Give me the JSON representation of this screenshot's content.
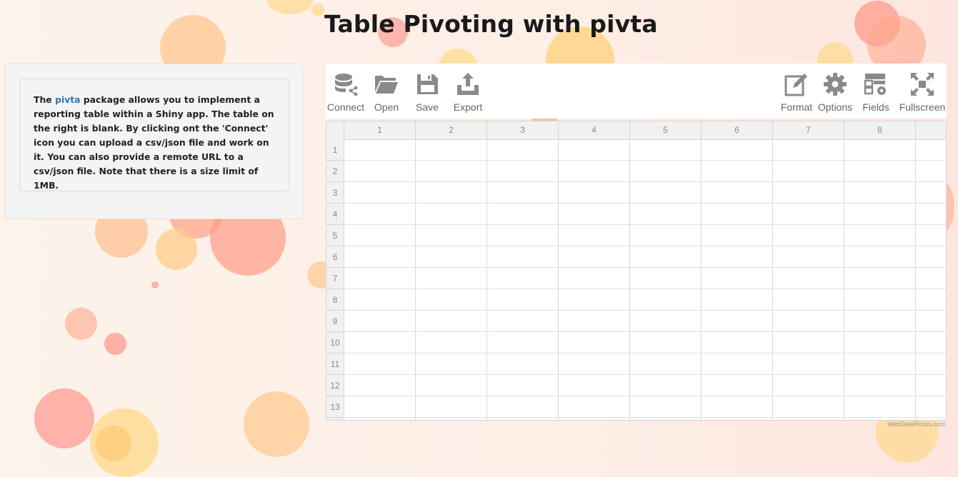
{
  "page": {
    "title": "Table Pivoting with pivta"
  },
  "info": {
    "text_before_link": "The ",
    "link_text": "pivta",
    "text_after_link": " package allows you to implement a reporting table within a Shiny app. The table on the right is blank. By clicking ont the 'Connect' icon you can upload a csv/json file and work on it. You can also provide a remote URL to a csv/json file. Note that there is a size limit of 1MB."
  },
  "toolbar": {
    "connect_label": "Connect",
    "open_label": "Open",
    "save_label": "Save",
    "export_label": "Export",
    "format_label": "Format",
    "options_label": "Options",
    "fields_label": "Fields",
    "fullscreen_label": "Fullscreen"
  },
  "grid": {
    "columns": [
      "1",
      "2",
      "3",
      "4",
      "5",
      "6",
      "7",
      "8"
    ],
    "rows": [
      "1",
      "2",
      "3",
      "4",
      "5",
      "6",
      "7",
      "8",
      "9",
      "10",
      "11",
      "12",
      "13"
    ]
  },
  "footer": {
    "credit": "WebDataRocks.com"
  },
  "colors": {
    "icon": "#8a8a8a",
    "link": "#2a7ab8",
    "bubble_peach": "#ffc890",
    "bubble_coral": "#ff9a85",
    "bubble_yellow": "#ffdc8a"
  }
}
